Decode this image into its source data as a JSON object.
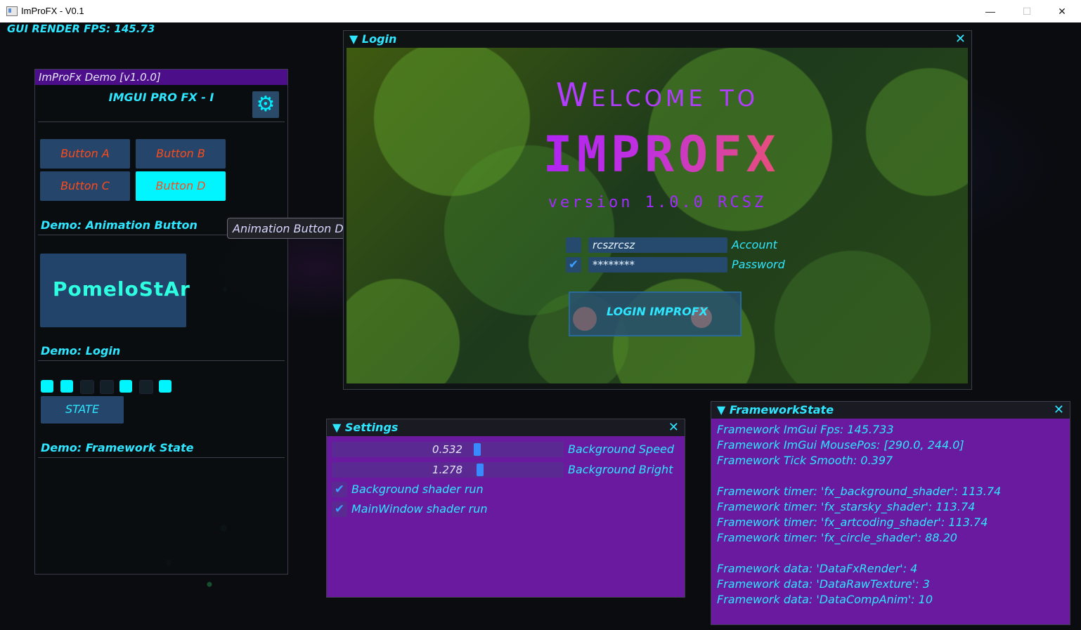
{
  "os_window": {
    "title": "ImProFX - V0.1",
    "minimize": "—",
    "maximize": "☐",
    "close": "✕"
  },
  "overlay": {
    "fps_text": "GUI RENDER FPS: 145.73"
  },
  "demo_window": {
    "title": "ImProFx Demo [v1.0.0]",
    "subtitle": "IMGUI PRO FX - I",
    "settings_icon": "gear-icon",
    "buttons": [
      "Button A",
      "Button B",
      "Button C",
      "Button D"
    ],
    "active_button": "Button D",
    "section_animation": "Demo: Animation Button",
    "logo_text": "PomeloStAr",
    "section_login": "Demo: Login",
    "indicator_states": [
      true,
      true,
      false,
      false,
      true,
      false,
      true
    ],
    "state_button": "STATE",
    "section_framework": "Demo: Framework State"
  },
  "tooltip": {
    "text": "Animation Button DemoD."
  },
  "login_window": {
    "title": "Login",
    "welcome": "Welcome to",
    "brand": "IMPROFX",
    "version": "version 1.0.0 RCSZ",
    "account_value": "rcszrcsz",
    "account_label": "Account",
    "account_checked": false,
    "password_value": "********",
    "password_label": "Password",
    "password_checked": true,
    "login_button": "LOGIN IMPROFX"
  },
  "settings_window": {
    "title": "Settings",
    "sliders": [
      {
        "label": "Background Speed",
        "value": "0.532",
        "fraction": 0.62
      },
      {
        "label": "Background Bright",
        "value": "1.278",
        "fraction": 0.64
      }
    ],
    "checkboxes": [
      {
        "label": "Background shader run",
        "checked": true
      },
      {
        "label": "MainWindow shader run",
        "checked": true
      }
    ]
  },
  "framework_window": {
    "title": "FrameworkState",
    "lines": [
      "Framework ImGui Fps: 145.733",
      "Framework ImGui MousePos: [290.0, 244.0]",
      "Framework Tick Smooth: 0.397",
      "",
      "Framework timer: 'fx_background_shader': 113.74",
      "Framework timer: 'fx_starsky_shader': 113.74",
      "Framework timer: 'fx_artcoding_shader': 113.74",
      "Framework timer: 'fx_circle_shader': 88.20",
      "",
      "Framework data: 'DataFxRender': 4",
      "Framework data: 'DataRawTexture': 3",
      "Framework data: 'DataCompAnim': 10"
    ]
  },
  "colors": {
    "accent_cyan": "#2ee6ff",
    "purple_panel": "#6a1a9e",
    "orange_text": "#ff4a1a"
  }
}
